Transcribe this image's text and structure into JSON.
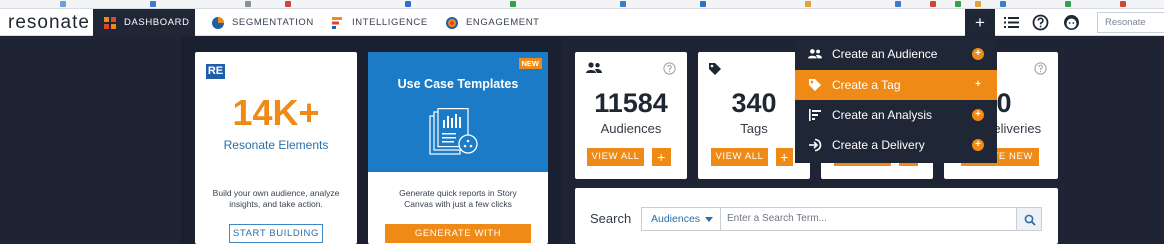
{
  "brand": {
    "logo": "resonate"
  },
  "nav": {
    "tabs": [
      {
        "label": "DASHBOARD"
      },
      {
        "label": "SEGMENTATION"
      },
      {
        "label": "INTELLIGENCE"
      },
      {
        "label": "ENGAGEMENT"
      }
    ],
    "add_label": "+",
    "search_placeholder": "Resonate"
  },
  "elements_card": {
    "badge": "RE",
    "big_value": "14K+",
    "title": "Resonate Elements",
    "description": "Build your own audience, analyze insights, and take action.",
    "button": "START BUILDING"
  },
  "templates_card": {
    "new_badge": "NEW",
    "title": "Use Case Templates",
    "description": "Generate quick reports in Story Canvas with just a few clicks",
    "button": "GENERATE WITH TEMPLATES"
  },
  "stats": [
    {
      "value": "11584",
      "label": "Audiences",
      "view_all": "VIEW ALL",
      "add": "+"
    },
    {
      "value": "340",
      "label": "Tags",
      "view_all": "VIEW ALL",
      "add": "+"
    },
    {
      "value": "0",
      "label": "Deliveries",
      "button": "CREATE NEW"
    }
  ],
  "create_menu": {
    "items": [
      {
        "label": "Create an Audience",
        "icon": "people-icon"
      },
      {
        "label": "Create a Tag",
        "icon": "tag-icon"
      },
      {
        "label": "Create an Analysis",
        "icon": "analysis-icon"
      },
      {
        "label": "Create a Delivery",
        "icon": "delivery-icon"
      }
    ],
    "plus": "+"
  },
  "search": {
    "label": "Search",
    "scope": "Audiences",
    "placeholder": "Enter a Search Term..."
  },
  "colors": {
    "accent": "#ef8a17",
    "nav_dark": "#1f2636",
    "link_blue": "#2b6fa8",
    "template_blue": "#1b7bc6"
  }
}
